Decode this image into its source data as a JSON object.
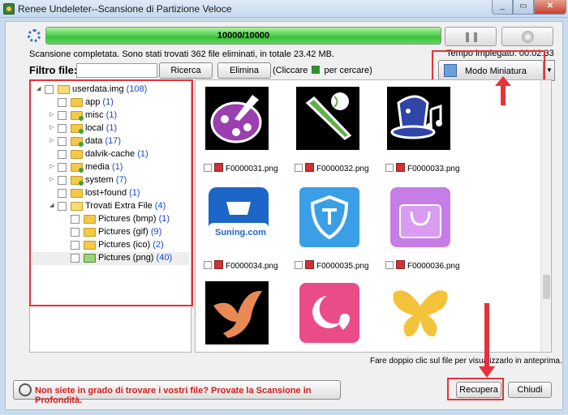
{
  "window": {
    "title": "Renee Undeleter--Scansione di Partizione Veloce"
  },
  "scan": {
    "progress_text": "10000/10000",
    "progress_fraction": 1.0,
    "status": "Scansione completata. Sono stati trovati 362 file eliminati, in totale 23.42 MB.",
    "time_used": "Tempo impiegato: 00:02:33"
  },
  "filter": {
    "label": "Filtro file:",
    "value": "",
    "search_label": "Ricerca",
    "delete_label": "Elimina",
    "hint_before": "(Cliccare",
    "hint_after": "per cercare)"
  },
  "view_mode": {
    "label": "Modo Miniatura"
  },
  "tree": [
    {
      "label": "userdata.img",
      "count": "(108)",
      "level": 0,
      "twisty": "open"
    },
    {
      "label": "app",
      "count": "(1)",
      "level": 1,
      "twisty": "none"
    },
    {
      "label": "misc",
      "count": "(1)",
      "level": 1,
      "twisty": "closed",
      "extra": true
    },
    {
      "label": "local",
      "count": "(1)",
      "level": 1,
      "twisty": "closed",
      "extra": true
    },
    {
      "label": "data",
      "count": "(17)",
      "level": 1,
      "twisty": "closed",
      "extra": true
    },
    {
      "label": "dalvik-cache",
      "count": "(1)",
      "level": 1,
      "twisty": "none"
    },
    {
      "label": "media",
      "count": "(1)",
      "level": 1,
      "twisty": "closed",
      "extra": true
    },
    {
      "label": "system",
      "count": "(7)",
      "level": 1,
      "twisty": "closed",
      "extra": true
    },
    {
      "label": "lost+found",
      "count": "(1)",
      "level": 1,
      "twisty": "none"
    },
    {
      "label": "Trovati Extra File",
      "count": "(4)",
      "level": 1,
      "twisty": "open"
    },
    {
      "label": "Pictures (bmp)",
      "count": "(1)",
      "level": 2,
      "twisty": "none"
    },
    {
      "label": "Pictures (gif)",
      "count": "(9)",
      "level": 2,
      "twisty": "none"
    },
    {
      "label": "Pictures (ico)",
      "count": "(2)",
      "level": 2,
      "twisty": "none"
    },
    {
      "label": "Pictures (png)",
      "count": "(40)",
      "level": 2,
      "twisty": "none",
      "selected": true
    }
  ],
  "files": [
    {
      "name": "F0000031.png",
      "icon": "palette-icon"
    },
    {
      "name": "F0000032.png",
      "icon": "baseball-bat-icon"
    },
    {
      "name": "F0000033.png",
      "icon": "magic-hat-music-icon"
    },
    {
      "name": "F0000034.png",
      "icon": "suning-cart-icon",
      "logo_text": "Suning.com"
    },
    {
      "name": "F0000035.png",
      "icon": "shield-icon"
    },
    {
      "name": "F0000036.png",
      "icon": "shopping-bag-icon"
    },
    {
      "name": "",
      "icon": "bird-icon"
    },
    {
      "name": "",
      "icon": "moon-heart-icon"
    },
    {
      "name": "",
      "icon": "butterfly-icon"
    }
  ],
  "footer": {
    "double_click_hint": "Fare doppio clic sul file per visualizzarlo in anteprima.",
    "deep_scan_text": "Non siete in grado di trovare i vostri file? Provate la Scansione in Profondità.",
    "recover_label": "Recupera",
    "close_label": "Chiudi"
  },
  "colors": {
    "accent_red": "#e5323a",
    "progress_green": "#39c23a",
    "count_blue": "#1a48c4",
    "deep_scan_red": "#d31c1c"
  }
}
